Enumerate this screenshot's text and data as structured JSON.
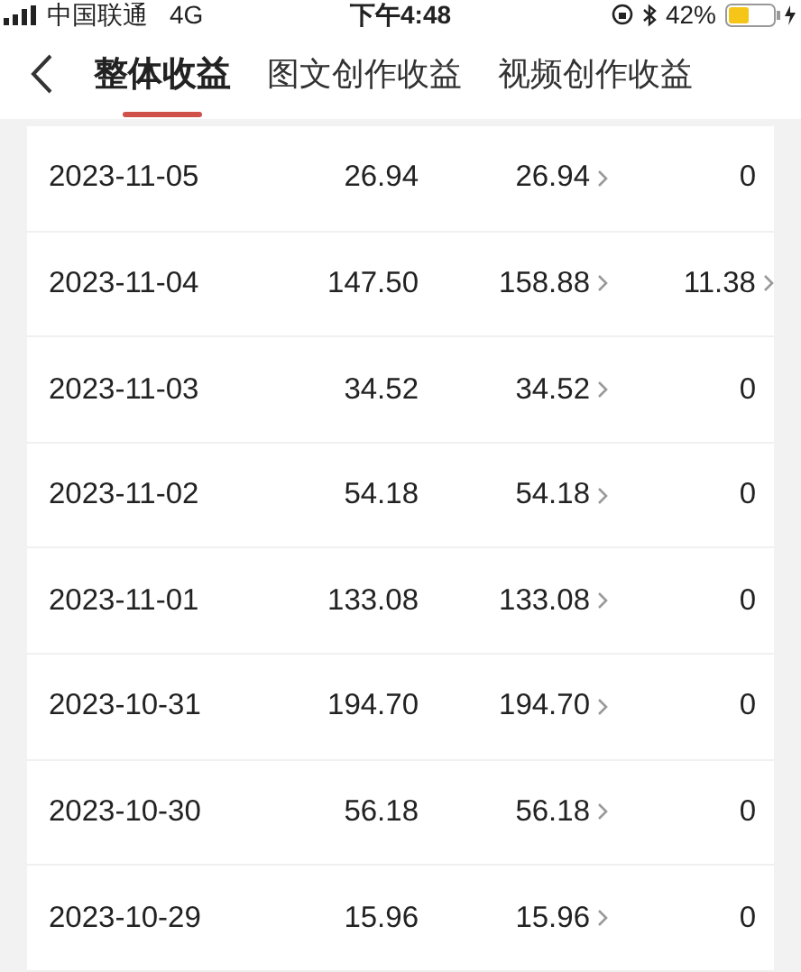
{
  "status_bar": {
    "carrier": "中国联通",
    "network": "4G",
    "time": "下午4:48",
    "battery": "42%"
  },
  "tabs": [
    {
      "label": "整体收益",
      "selected": true
    },
    {
      "label": "图文创作收益",
      "selected": false
    },
    {
      "label": "视频创作收益",
      "selected": false
    }
  ],
  "rows": [
    {
      "date": "2023-11-05",
      "total": "26.94",
      "image_text": "26.94",
      "image_text_detail": true,
      "video": "0",
      "video_detail": false
    },
    {
      "date": "2023-11-04",
      "total": "147.50",
      "image_text": "158.88",
      "image_text_detail": true,
      "video": "11.38",
      "video_detail": true
    },
    {
      "date": "2023-11-03",
      "total": "34.52",
      "image_text": "34.52",
      "image_text_detail": true,
      "video": "0",
      "video_detail": false
    },
    {
      "date": "2023-11-02",
      "total": "54.18",
      "image_text": "54.18",
      "image_text_detail": true,
      "video": "0",
      "video_detail": false
    },
    {
      "date": "2023-11-01",
      "total": "133.08",
      "image_text": "133.08",
      "image_text_detail": true,
      "video": "0",
      "video_detail": false
    },
    {
      "date": "2023-10-31",
      "total": "194.70",
      "image_text": "194.70",
      "image_text_detail": true,
      "video": "0",
      "video_detail": false
    },
    {
      "date": "2023-10-30",
      "total": "56.18",
      "image_text": "56.18",
      "image_text_detail": true,
      "video": "0",
      "video_detail": false
    },
    {
      "date": "2023-10-29",
      "total": "15.96",
      "image_text": "15.96",
      "image_text_detail": true,
      "video": "0",
      "video_detail": false
    }
  ]
}
